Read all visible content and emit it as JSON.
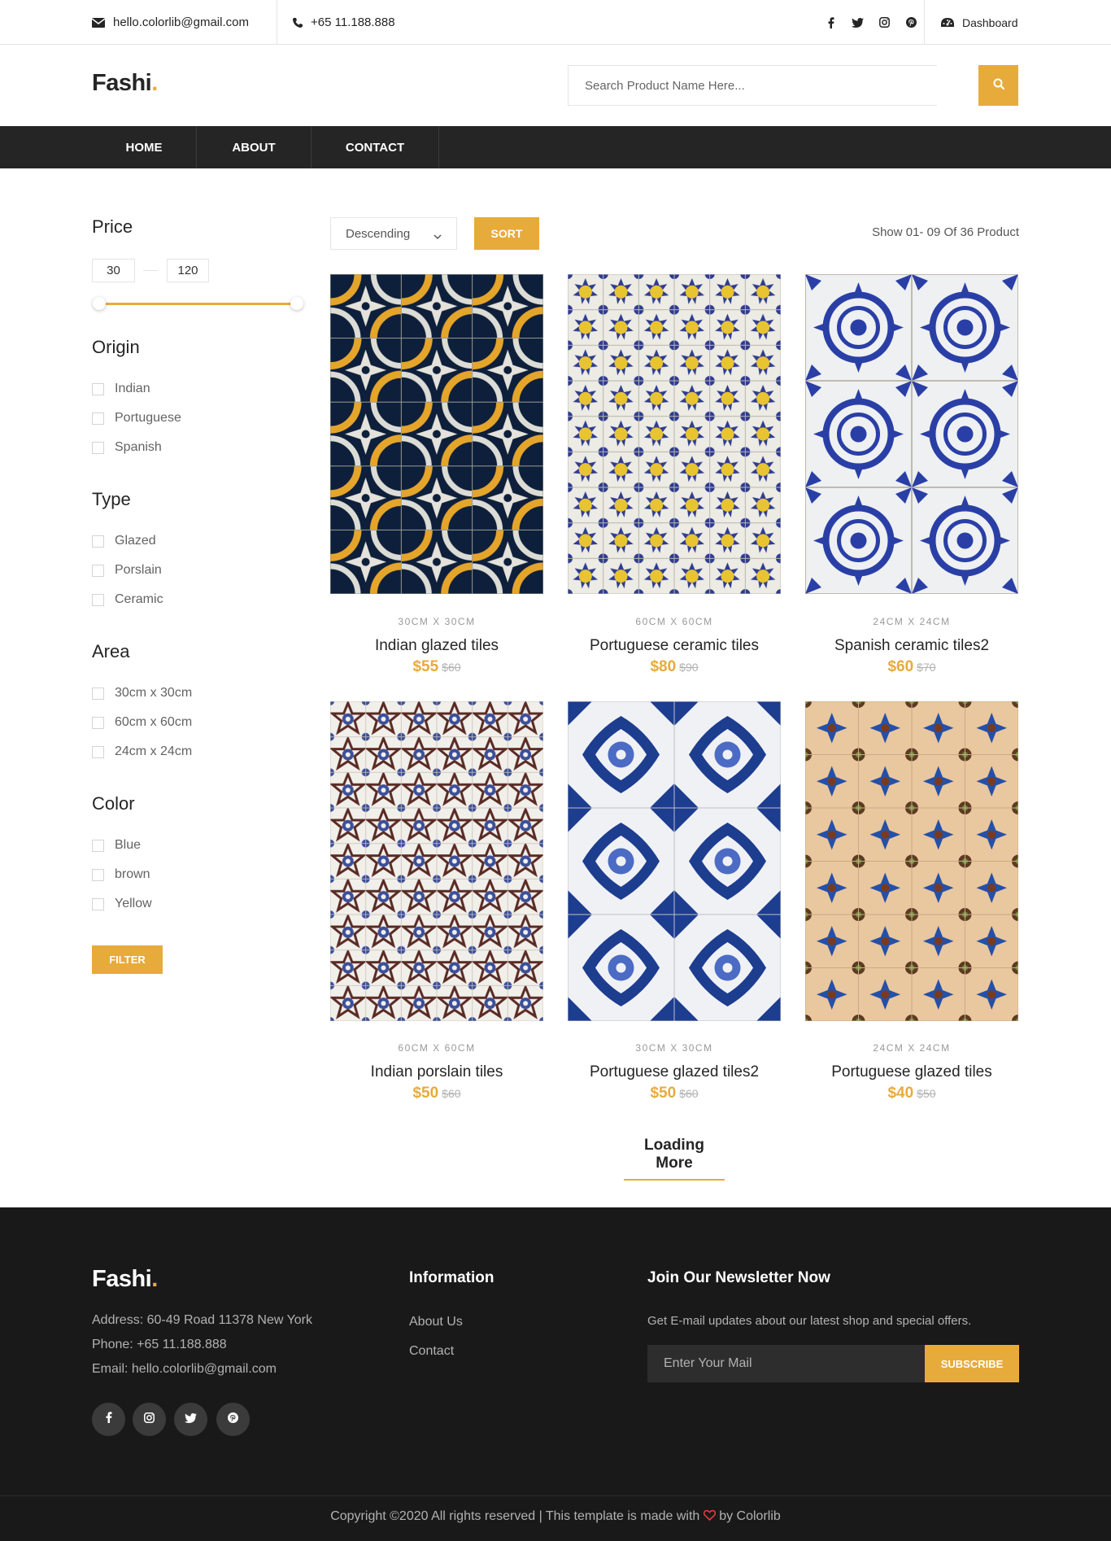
{
  "topbar": {
    "email": "hello.colorlib@gmail.com",
    "phone": "+65 11.188.888",
    "dashboard": "Dashboard"
  },
  "header": {
    "logo_text": "Fashi",
    "logo_dot": ".",
    "search_placeholder": "Search Product Name Here..."
  },
  "nav": [
    "HOME",
    "ABOUT",
    "CONTACT"
  ],
  "sidebar": {
    "price": {
      "title": "Price",
      "min": "30",
      "max": "120",
      "range": [
        30,
        120
      ]
    },
    "origin": {
      "title": "Origin",
      "options": [
        "Indian",
        "Portuguese",
        "Spanish"
      ]
    },
    "type": {
      "title": "Type",
      "options": [
        "Glazed",
        "Porslain",
        "Ceramic"
      ]
    },
    "area": {
      "title": "Area",
      "options": [
        "30cm x 30cm",
        "60cm x 60cm",
        "24cm x 24cm"
      ]
    },
    "color": {
      "title": "Color",
      "options": [
        "Blue",
        "brown",
        "Yellow"
      ]
    },
    "filter_label": "FILTER"
  },
  "toolbar": {
    "sort_select": "Descending",
    "sort_label": "SORT",
    "show_count": "Show 01- 09 Of 36 Product"
  },
  "products": [
    {
      "size": "30CM X 30CM",
      "name": "Indian glazed tiles",
      "price": "$55",
      "old_price": "$60"
    },
    {
      "size": "60CM X 60CM",
      "name": "Portuguese ceramic tiles",
      "price": "$80",
      "old_price": "$90"
    },
    {
      "size": "24CM X 24CM",
      "name": "Spanish ceramic tiles2",
      "price": "$60",
      "old_price": "$70"
    },
    {
      "size": "60CM X 60CM",
      "name": "Indian porslain tiles",
      "price": "$50",
      "old_price": "$60"
    },
    {
      "size": "30CM X 30CM",
      "name": "Portuguese glazed tiles2",
      "price": "$50",
      "old_price": "$60"
    },
    {
      "size": "24CM X 24CM",
      "name": "Portuguese glazed tiles",
      "price": "$40",
      "old_price": "$50"
    }
  ],
  "loading_more": "Loading More",
  "footer": {
    "logo_text": "Fashi",
    "logo_dot": ".",
    "address": "Address: 60-49 Road 11378 New York",
    "phone": "Phone: +65 11.188.888",
    "email": "Email: hello.colorlib@gmail.com",
    "info_title": "Information",
    "info_links": [
      "About Us",
      "Contact"
    ],
    "newsletter_title": "Join Our Newsletter Now",
    "newsletter_text": "Get E-mail updates about our latest shop and special offers.",
    "mail_placeholder": "Enter Your Mail",
    "subscribe_label": "SUBSCRIBE",
    "copyright_prefix": "Copyright ©2020 All rights reserved | This template is made with",
    "copyright_suffix": "by Colorlib"
  },
  "colors": {
    "accent": "#e7ab3c",
    "dark": "#252525",
    "footer": "#191919"
  }
}
